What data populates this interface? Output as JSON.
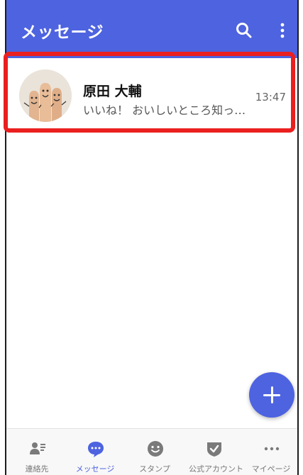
{
  "header": {
    "title": "メッセージ"
  },
  "chat": {
    "name": "原田 大輔",
    "preview": "いいね！ おいしいところ知っ…",
    "time": "13:47"
  },
  "tabs": [
    {
      "label": "連絡先",
      "icon": "contacts-icon",
      "active": false
    },
    {
      "label": "メッセージ",
      "icon": "message-icon",
      "active": true
    },
    {
      "label": "スタンプ",
      "icon": "smile-icon",
      "active": false
    },
    {
      "label": "公式アカウント",
      "icon": "shield-check-icon",
      "active": false
    },
    {
      "label": "マイページ",
      "icon": "more-horizontal-icon",
      "active": false
    }
  ],
  "colors": {
    "primary": "#4e63e0",
    "highlight": "#ea1f1f",
    "inactive": "#777777"
  }
}
